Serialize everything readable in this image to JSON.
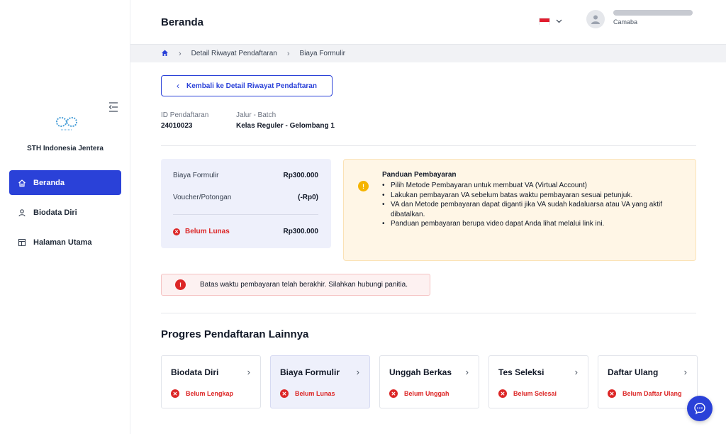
{
  "header": {
    "title": "Beranda",
    "user_role": "Camaba",
    "flag_colors": [
      "#e11d2e",
      "#ffffff"
    ]
  },
  "sidebar": {
    "org_name": "STH Indonesia Jentera",
    "items": [
      {
        "label": "Beranda",
        "icon": "home-icon",
        "active": true
      },
      {
        "label": "Biodata Diri",
        "icon": "user-icon",
        "active": false
      },
      {
        "label": "Halaman Utama",
        "icon": "layout-icon",
        "active": false
      }
    ]
  },
  "breadcrumb": {
    "items": [
      "Detail Riwayat Pendaftaran",
      "Biaya Formulir"
    ]
  },
  "back_button": "Kembali ke Detail Riwayat Pendaftaran",
  "registration": {
    "id_label": "ID Pendaftaran",
    "id_value": "24010023",
    "path_label": "Jalur - Batch",
    "path_value": "Kelas Reguler - Gelombang 1"
  },
  "summary": {
    "fee_label": "Biaya Formulir",
    "fee_value": "Rp300.000",
    "voucher_label": "Voucher/Potongan",
    "voucher_value": "(-Rp0)",
    "status_label": "Belum Lunas",
    "total_value": "Rp300.000"
  },
  "guide": {
    "title": "Panduan Pembayaran",
    "items": [
      "Pilih Metode Pembayaran untuk membuat VA (Virtual Account)",
      "Lakukan pembayaran VA sebelum batas waktu pembayaran sesuai petunjuk.",
      "VA dan Metode pembayaran dapat diganti jika VA sudah kadaluarsa atau VA yang aktif dibatalkan.",
      "Panduan pembayaran berupa video dapat Anda lihat melalui link ini."
    ]
  },
  "alert": "Batas waktu pembayaran telah berakhir. Silahkan hubungi panitia.",
  "progress": {
    "title": "Progres Pendaftaran Lainnya",
    "cards": [
      {
        "title": "Biodata Diri",
        "status": "Belum Lengkap",
        "active": false
      },
      {
        "title": "Biaya Formulir",
        "status": "Belum Lunas",
        "active": true
      },
      {
        "title": "Unggah Berkas",
        "status": "Belum Unggah",
        "active": false
      },
      {
        "title": "Tes Seleksi",
        "status": "Belum Selesai",
        "active": false
      },
      {
        "title": "Daftar Ulang",
        "status": "Belum Daftar Ulang",
        "active": false
      }
    ]
  },
  "colors": {
    "primary": "#2a41d8",
    "danger": "#dc2626",
    "warning": "#f5b400"
  }
}
